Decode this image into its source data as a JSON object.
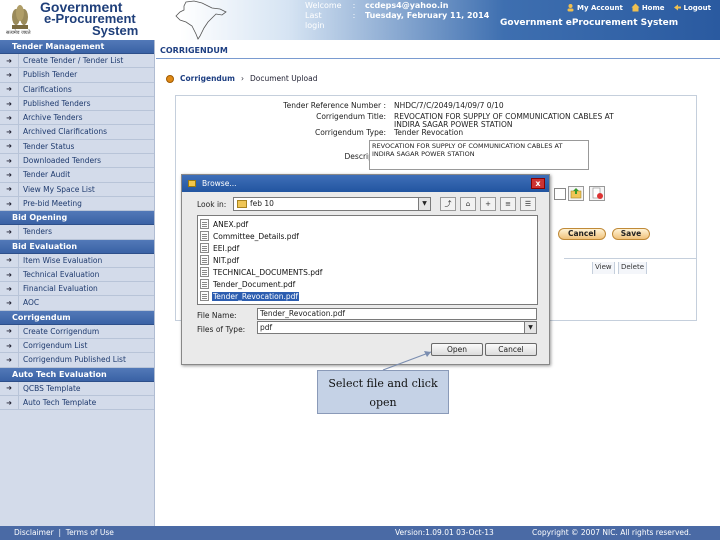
{
  "header": {
    "logo_line1": "Government",
    "logo_line2": "e-Procurement",
    "logo_line3": "System",
    "emblem_caption": "सत्यमेव जयते",
    "welcome_label": "Welcome",
    "welcome_value": "ccdeps4@yahoo.in",
    "lastlogin_label": "Last login",
    "lastlogin_value": "Tuesday, February 11, 2014",
    "separator": ":",
    "links": {
      "my_account": "My Account",
      "home": "Home",
      "logout": "Logout"
    },
    "system_title": "Government eProcurement System"
  },
  "sidebar": {
    "sections": [
      {
        "title": "Tender Management",
        "items": [
          "Create Tender / Tender List",
          "Publish Tender",
          "Clarifications",
          "Published Tenders",
          "Archive Tenders",
          "Archived Clarifications",
          "Tender Status",
          "Downloaded Tenders",
          "Tender Audit",
          "View My Space List",
          "Pre-bid Meeting"
        ]
      },
      {
        "title": "Bid Opening",
        "items": [
          "Tenders"
        ]
      },
      {
        "title": "Bid Evaluation",
        "items": [
          "Item Wise Evaluation",
          "Technical Evaluation",
          "Financial Evaluation",
          "AOC"
        ]
      },
      {
        "title": "Corrigendum",
        "items": [
          "Create Corrigendum",
          "Corrigendum List",
          "Corrigendum Published List"
        ]
      },
      {
        "title": "Auto Tech Evaluation",
        "items": [
          "QCBS Template",
          "Auto Tech Template"
        ]
      }
    ]
  },
  "content": {
    "title": "CORRIGENDUM",
    "breadcrumb": {
      "first": "Corrigendum",
      "sep": "›",
      "current": "Document Upload"
    },
    "form": {
      "ref_label": "Tender Reference Number :",
      "ref_value": "NHDC/7/C/2049/14/09/7 0/10",
      "title_label": "Corrigendum Title:",
      "title_value1": "REVOCATION FOR SUPPLY OF COMMUNICATION CABLES AT",
      "title_value2": "INDIRA SAGAR POWER STATION",
      "type_label": "Corrigendum Type:",
      "type_value": "Tender Revocation",
      "desc_label": "Description*",
      "desc_value": "REVOCATION FOR SUPPLY OF COMMUNICATION CABLES AT INDIRA SAGAR POWER STATION",
      "cancel_label": "Cancel",
      "save_label": "Save",
      "grid_view": "View",
      "grid_delete": "Delete"
    }
  },
  "dialog": {
    "title": "Browse...",
    "close": "x",
    "lookin_label": "Look in:",
    "lookin_value": "feb 10",
    "files": [
      "ANEX.pdf",
      "Committee_Details.pdf",
      "EEI.pdf",
      "NIT.pdf",
      "TECHNICAL_DOCUMENTS.pdf",
      "Tender_Document.pdf",
      "Tender_Revocation.pdf"
    ],
    "selected_file": "Tender_Revocation.pdf",
    "filename_label": "File Name:",
    "filename_value": "Tender_Revocation.pdf",
    "filetype_label": "Files of Type:",
    "filetype_value": "pdf",
    "open_label": "Open",
    "cancel_label": "Cancel"
  },
  "callout": {
    "line1": "Select file and click",
    "line2": "open"
  },
  "footer": {
    "disclaimer": "Disclaimer",
    "divider": "|",
    "terms": "Terms of Use",
    "version": "Version:1.09.01 03-Oct-13",
    "copyright": "Copyright © 2007 NIC. All rights reserved."
  },
  "colors": {
    "header_blue": "#2a5aa0",
    "sidebar_bg": "#d3dbea",
    "section_blue": "#3a62a5",
    "button_orange": "#f0c27a",
    "selection_blue": "#2c5db0"
  }
}
